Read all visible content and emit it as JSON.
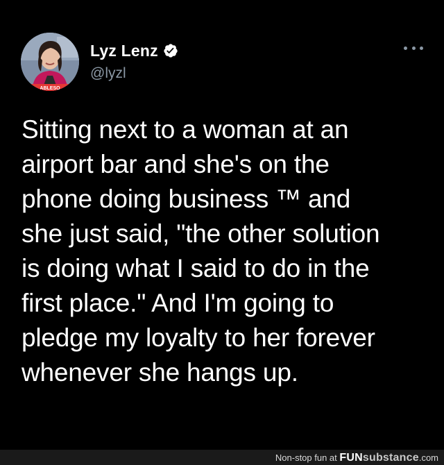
{
  "tweet": {
    "author": {
      "display_name": "Lyz Lenz",
      "handle": "@lyzl",
      "verified": true,
      "verified_icon": "verified-badge-icon",
      "avatar_icon": "profile-photo"
    },
    "more_icon": "more-options-icon",
    "text": "Sitting next to a woman at an\nairport bar and she's on the\nphone doing business ™ and\nshe just said, \"the other solution\nis doing what I said to do in the\nfirst place.\" And I'm going to\npledge my loyalty to her forever\nwhenever she hangs up."
  },
  "watermark": {
    "prefix": "Non-stop fun at ",
    "brand_fun": "FUN",
    "brand_substance": "substance",
    "suffix": ".com"
  },
  "colors": {
    "background": "#000000",
    "text": "#ffffff",
    "secondary": "#8b98a5",
    "verified": "#ffffff",
    "footer": "#1a1a1a"
  }
}
